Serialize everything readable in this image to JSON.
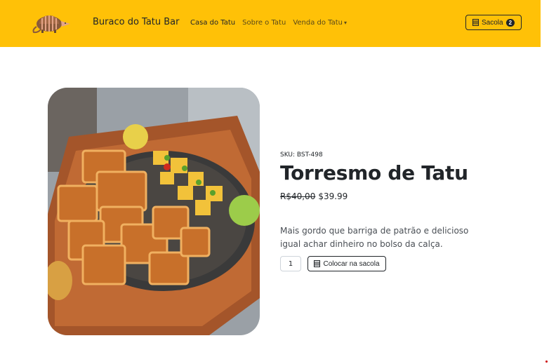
{
  "navbar": {
    "brand": "Buraco do Tatu Bar",
    "links": [
      {
        "label": "Casa do Tatu"
      },
      {
        "label": "Sobre o Tatu"
      },
      {
        "label": "Venda do Tatu"
      }
    ],
    "cart_label": "Sacola",
    "cart_count": "2",
    "bg_color": "#ffc107"
  },
  "product": {
    "sku": "SKU: BST-498",
    "title": "Torresmo de Tatu",
    "old_price": "R$40,00",
    "price": "$39.99",
    "description": "Mais gordo que barriga de patrão e delicioso igual achar dinheiro no bolso da calça.",
    "quantity": "1",
    "add_button": "Colocar na sacola"
  },
  "icons": {
    "logo": "armadillo-logo",
    "cart": "bag-icon"
  }
}
